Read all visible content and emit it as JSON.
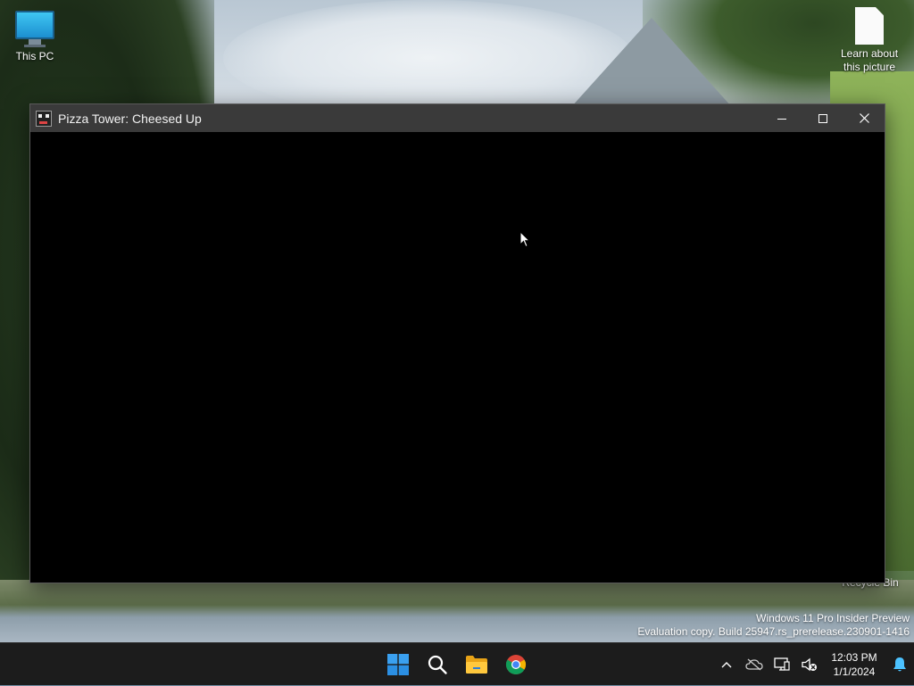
{
  "desktop": {
    "icons": [
      {
        "label": "This PC"
      },
      {
        "label_line1": "Learn about",
        "label_line2": "this picture"
      },
      {
        "label": "Recycle Bin"
      }
    ],
    "watermark": {
      "line1": "Windows 11 Pro Insider Preview",
      "line2": "Evaluation copy. Build 25947.rs_prerelease.230901-1416"
    }
  },
  "window": {
    "title": "Pizza Tower: Cheesed Up",
    "controls": {
      "minimize": "minimize-icon",
      "maximize": "maximize-icon",
      "close": "close-icon"
    },
    "client_background": "#000000"
  },
  "taskbar": {
    "apps": [
      {
        "name": "start",
        "icon": "windows-logo-icon"
      },
      {
        "name": "search",
        "icon": "search-icon"
      },
      {
        "name": "file-explorer",
        "icon": "folder-icon"
      },
      {
        "name": "chrome",
        "icon": "chrome-icon"
      }
    ],
    "tray": {
      "icons": [
        "chevron-up-icon",
        "onedrive-offline-icon",
        "network-icon",
        "volume-muted-icon"
      ],
      "time": "12:03 PM",
      "date": "1/1/2024",
      "notification_icon": "bell-icon"
    }
  },
  "colors": {
    "taskbar_bg": "#1c1c1c",
    "titlebar_bg": "#3a3a3a",
    "accent": "#0078d4"
  }
}
